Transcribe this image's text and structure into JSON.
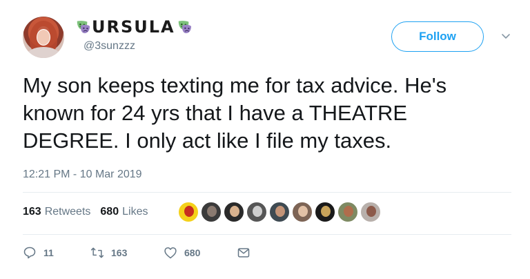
{
  "author": {
    "display_name": "URSULA",
    "handle": "@3sunzzz",
    "avatar_icon": "profile-avatar",
    "name_decoration_icon": "theatre-masks-icon"
  },
  "follow_button": {
    "label": "Follow"
  },
  "menu_icon": "chevron-down-icon",
  "tweet": {
    "text": "My son keeps texting me for tax advice. He's known for 24 yrs that I have a THEATRE DEGREE. I only act like I file my taxes.",
    "timestamp": "12:21 PM - 10 Mar 2019"
  },
  "stats": {
    "retweets_count": "163",
    "retweets_label": "Retweets",
    "likes_count": "680",
    "likes_label": "Likes"
  },
  "liker_avatars": [
    {
      "bg": "#f4d11a",
      "fg": "#c72d1f"
    },
    {
      "bg": "#3b3b3b",
      "fg": "#8a7a70"
    },
    {
      "bg": "#2a2a2a",
      "fg": "#d9b28e"
    },
    {
      "bg": "#565656",
      "fg": "#cfcfcf"
    },
    {
      "bg": "#3e4a52",
      "fg": "#c39478"
    },
    {
      "bg": "#7d6455",
      "fg": "#e2c1a6"
    },
    {
      "bg": "#1a1a1a",
      "fg": "#c8a35a"
    },
    {
      "bg": "#7e8a62",
      "fg": "#b06d4c"
    },
    {
      "bg": "#b8b0ab",
      "fg": "#8c5a4a"
    }
  ],
  "actions": {
    "reply_count": "11",
    "retweet_count": "163",
    "like_count": "680"
  },
  "colors": {
    "accent": "#1da1f2",
    "muted": "#657786",
    "mask_green": "#7dc27b",
    "mask_purple": "#9b84c6"
  }
}
